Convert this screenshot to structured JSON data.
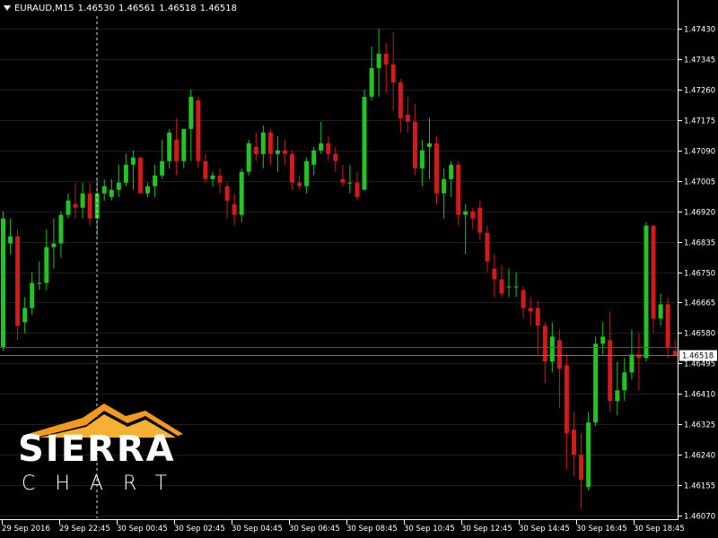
{
  "header": {
    "symbol": "EURAUD,M15",
    "open": "1.46530",
    "high": "1.46561",
    "low": "1.46518",
    "close": "1.46518"
  },
  "logo": {
    "line1": "SIERRA",
    "line2": "CHART"
  },
  "colors": {
    "background": "#000000",
    "bull": "#22c322",
    "bear": "#d11a1a",
    "grid": "#1e1e1e",
    "axis": "#ffffff",
    "logo_orange": "#f29a1f"
  },
  "chart_data": {
    "type": "candlestick",
    "title": "",
    "y_ticks": [
      "1.47430",
      "1.47345",
      "1.47260",
      "1.47175",
      "1.47090",
      "1.47005",
      "1.46920",
      "1.46835",
      "1.46750",
      "1.46665",
      "1.46580",
      "1.46495",
      "1.46410",
      "1.46325",
      "1.46240",
      "1.46155",
      "1.46070"
    ],
    "x_ticks": [
      "29 Sep 2016",
      "29 Sep 22:45",
      "30 Sep 00:45",
      "30 Sep 02:45",
      "30 Sep 04:45",
      "30 Sep 06:45",
      "30 Sep 08:45",
      "30 Sep 10:45",
      "30 Sep 12:45",
      "30 Sep 14:45",
      "30 Sep 16:45",
      "30 Sep 18:45"
    ],
    "ylim": [
      1.46055,
      1.47475
    ],
    "current_price": "1.46518",
    "candles": [
      {
        "o": 1.4654,
        "h": 1.4692,
        "l": 1.4653,
        "c": 1.469
      },
      {
        "o": 1.4683,
        "h": 1.469,
        "l": 1.468,
        "c": 1.4685
      },
      {
        "o": 1.4685,
        "h": 1.4687,
        "l": 1.4656,
        "c": 1.466
      },
      {
        "o": 1.4661,
        "h": 1.4668,
        "l": 1.4658,
        "c": 1.4665
      },
      {
        "o": 1.4665,
        "h": 1.4675,
        "l": 1.4663,
        "c": 1.4672
      },
      {
        "o": 1.4672,
        "h": 1.4678,
        "l": 1.467,
        "c": 1.4672
      },
      {
        "o": 1.4672,
        "h": 1.4687,
        "l": 1.467,
        "c": 1.4682
      },
      {
        "o": 1.4682,
        "h": 1.469,
        "l": 1.4676,
        "c": 1.4683
      },
      {
        "o": 1.4683,
        "h": 1.4692,
        "l": 1.4679,
        "c": 1.4691
      },
      {
        "o": 1.4691,
        "h": 1.4697,
        "l": 1.469,
        "c": 1.4695
      },
      {
        "o": 1.4694,
        "h": 1.47,
        "l": 1.469,
        "c": 1.4693
      },
      {
        "o": 1.4693,
        "h": 1.47,
        "l": 1.469,
        "c": 1.4697
      },
      {
        "o": 1.4697,
        "h": 1.47,
        "l": 1.4688,
        "c": 1.469
      },
      {
        "o": 1.469,
        "h": 1.4701,
        "l": 1.4685,
        "c": 1.4697
      },
      {
        "o": 1.4697,
        "h": 1.4701,
        "l": 1.4695,
        "c": 1.4699
      },
      {
        "o": 1.4696,
        "h": 1.4701,
        "l": 1.4695,
        "c": 1.4698
      },
      {
        "o": 1.4698,
        "h": 1.4705,
        "l": 1.4696,
        "c": 1.47
      },
      {
        "o": 1.47,
        "h": 1.4708,
        "l": 1.4699,
        "c": 1.4705
      },
      {
        "o": 1.4705,
        "h": 1.4709,
        "l": 1.4698,
        "c": 1.4707
      },
      {
        "o": 1.4707,
        "h": 1.4707,
        "l": 1.4699,
        "c": 1.4697
      },
      {
        "o": 1.4697,
        "h": 1.47,
        "l": 1.4696,
        "c": 1.4699
      },
      {
        "o": 1.4699,
        "h": 1.4705,
        "l": 1.4696,
        "c": 1.4702
      },
      {
        "o": 1.4702,
        "h": 1.4712,
        "l": 1.4701,
        "c": 1.4706
      },
      {
        "o": 1.4706,
        "h": 1.4715,
        "l": 1.4704,
        "c": 1.4714
      },
      {
        "o": 1.4712,
        "h": 1.4718,
        "l": 1.4702,
        "c": 1.4706
      },
      {
        "o": 1.4706,
        "h": 1.4715,
        "l": 1.4704,
        "c": 1.4715
      },
      {
        "o": 1.4715,
        "h": 1.4726,
        "l": 1.4706,
        "c": 1.4724
      },
      {
        "o": 1.4723,
        "h": 1.4724,
        "l": 1.4704,
        "c": 1.4706
      },
      {
        "o": 1.4706,
        "h": 1.4708,
        "l": 1.47,
        "c": 1.4701
      },
      {
        "o": 1.4701,
        "h": 1.4703,
        "l": 1.4699,
        "c": 1.4702
      },
      {
        "o": 1.4702,
        "h": 1.4704,
        "l": 1.4697,
        "c": 1.47
      },
      {
        "o": 1.4699,
        "h": 1.47,
        "l": 1.469,
        "c": 1.4695
      },
      {
        "o": 1.4694,
        "h": 1.4697,
        "l": 1.4688,
        "c": 1.4691
      },
      {
        "o": 1.4691,
        "h": 1.4704,
        "l": 1.4689,
        "c": 1.4703
      },
      {
        "o": 1.4703,
        "h": 1.4712,
        "l": 1.4702,
        "c": 1.4711
      },
      {
        "o": 1.471,
        "h": 1.4714,
        "l": 1.4706,
        "c": 1.4708
      },
      {
        "o": 1.4708,
        "h": 1.4716,
        "l": 1.4704,
        "c": 1.4714
      },
      {
        "o": 1.4714,
        "h": 1.4715,
        "l": 1.4705,
        "c": 1.4708
      },
      {
        "o": 1.4708,
        "h": 1.4713,
        "l": 1.4703,
        "c": 1.4709
      },
      {
        "o": 1.4709,
        "h": 1.4712,
        "l": 1.4705,
        "c": 1.4708
      },
      {
        "o": 1.4708,
        "h": 1.4709,
        "l": 1.4698,
        "c": 1.47
      },
      {
        "o": 1.47,
        "h": 1.4702,
        "l": 1.4698,
        "c": 1.4699
      },
      {
        "o": 1.4699,
        "h": 1.4707,
        "l": 1.4697,
        "c": 1.4706
      },
      {
        "o": 1.4705,
        "h": 1.471,
        "l": 1.4702,
        "c": 1.4709
      },
      {
        "o": 1.4709,
        "h": 1.4717,
        "l": 1.4708,
        "c": 1.4711
      },
      {
        "o": 1.4711,
        "h": 1.4713,
        "l": 1.4706,
        "c": 1.4708
      },
      {
        "o": 1.4708,
        "h": 1.471,
        "l": 1.4703,
        "c": 1.4706
      },
      {
        "o": 1.4701,
        "h": 1.4705,
        "l": 1.4699,
        "c": 1.47
      },
      {
        "o": 1.47,
        "h": 1.4705,
        "l": 1.4697,
        "c": 1.47
      },
      {
        "o": 1.47,
        "h": 1.4703,
        "l": 1.4695,
        "c": 1.4696
      },
      {
        "o": 1.4698,
        "h": 1.4726,
        "l": 1.4698,
        "c": 1.4724
      },
      {
        "o": 1.4724,
        "h": 1.4738,
        "l": 1.4723,
        "c": 1.4732
      },
      {
        "o": 1.4732,
        "h": 1.4743,
        "l": 1.4724,
        "c": 1.4736
      },
      {
        "o": 1.4736,
        "h": 1.4739,
        "l": 1.4725,
        "c": 1.4733
      },
      {
        "o": 1.4733,
        "h": 1.4742,
        "l": 1.472,
        "c": 1.4728
      },
      {
        "o": 1.4728,
        "h": 1.4729,
        "l": 1.4714,
        "c": 1.4718
      },
      {
        "o": 1.4719,
        "h": 1.4724,
        "l": 1.4714,
        "c": 1.4717
      },
      {
        "o": 1.4717,
        "h": 1.4722,
        "l": 1.4702,
        "c": 1.4704
      },
      {
        "o": 1.4704,
        "h": 1.4712,
        "l": 1.4699,
        "c": 1.4709
      },
      {
        "o": 1.471,
        "h": 1.4718,
        "l": 1.4701,
        "c": 1.4711
      },
      {
        "o": 1.4711,
        "h": 1.4713,
        "l": 1.4694,
        "c": 1.4697
      },
      {
        "o": 1.4697,
        "h": 1.4704,
        "l": 1.469,
        "c": 1.4701
      },
      {
        "o": 1.4701,
        "h": 1.4706,
        "l": 1.4696,
        "c": 1.4705
      },
      {
        "o": 1.4705,
        "h": 1.4706,
        "l": 1.4688,
        "c": 1.4691
      },
      {
        "o": 1.4691,
        "h": 1.4694,
        "l": 1.468,
        "c": 1.4692
      },
      {
        "o": 1.4692,
        "h": 1.4693,
        "l": 1.4687,
        "c": 1.469
      },
      {
        "o": 1.4693,
        "h": 1.4695,
        "l": 1.4684,
        "c": 1.4686
      },
      {
        "o": 1.4686,
        "h": 1.4688,
        "l": 1.4675,
        "c": 1.4678
      },
      {
        "o": 1.4676,
        "h": 1.468,
        "l": 1.4668,
        "c": 1.4673
      },
      {
        "o": 1.4673,
        "h": 1.4677,
        "l": 1.4668,
        "c": 1.4669
      },
      {
        "o": 1.4671,
        "h": 1.4676,
        "l": 1.4668,
        "c": 1.4671
      },
      {
        "o": 1.4671,
        "h": 1.4675,
        "l": 1.4668,
        "c": 1.4671
      },
      {
        "o": 1.467,
        "h": 1.4671,
        "l": 1.4662,
        "c": 1.4665
      },
      {
        "o": 1.4665,
        "h": 1.4668,
        "l": 1.466,
        "c": 1.4664
      },
      {
        "o": 1.4665,
        "h": 1.4667,
        "l": 1.4652,
        "c": 1.466
      },
      {
        "o": 1.466,
        "h": 1.4661,
        "l": 1.4644,
        "c": 1.465
      },
      {
        "o": 1.465,
        "h": 1.4661,
        "l": 1.4647,
        "c": 1.4657
      },
      {
        "o": 1.4656,
        "h": 1.4659,
        "l": 1.4637,
        "c": 1.4648
      },
      {
        "o": 1.4649,
        "h": 1.4652,
        "l": 1.462,
        "c": 1.463
      },
      {
        "o": 1.4631,
        "h": 1.4636,
        "l": 1.4618,
        "c": 1.4624
      },
      {
        "o": 1.4624,
        "h": 1.463,
        "l": 1.4609,
        "c": 1.4617
      },
      {
        "o": 1.4615,
        "h": 1.4636,
        "l": 1.4614,
        "c": 1.4633
      },
      {
        "o": 1.4633,
        "h": 1.4657,
        "l": 1.4632,
        "c": 1.4655
      },
      {
        "o": 1.4655,
        "h": 1.4661,
        "l": 1.4652,
        "c": 1.4657
      },
      {
        "o": 1.4656,
        "h": 1.4664,
        "l": 1.4636,
        "c": 1.4639
      },
      {
        "o": 1.4639,
        "h": 1.465,
        "l": 1.4635,
        "c": 1.4642
      },
      {
        "o": 1.4642,
        "h": 1.4651,
        "l": 1.4639,
        "c": 1.4647
      },
      {
        "o": 1.4647,
        "h": 1.4659,
        "l": 1.4645,
        "c": 1.4652
      },
      {
        "o": 1.4652,
        "h": 1.4658,
        "l": 1.4642,
        "c": 1.4651
      },
      {
        "o": 1.4651,
        "h": 1.4689,
        "l": 1.465,
        "c": 1.4688
      },
      {
        "o": 1.4688,
        "h": 1.4688,
        "l": 1.4658,
        "c": 1.4662
      },
      {
        "o": 1.4662,
        "h": 1.4669,
        "l": 1.466,
        "c": 1.4666
      },
      {
        "o": 1.4666,
        "h": 1.4668,
        "l": 1.4651,
        "c": 1.4654
      },
      {
        "o": 1.4653,
        "h": 1.46561,
        "l": 1.46518,
        "c": 1.46518
      }
    ]
  }
}
